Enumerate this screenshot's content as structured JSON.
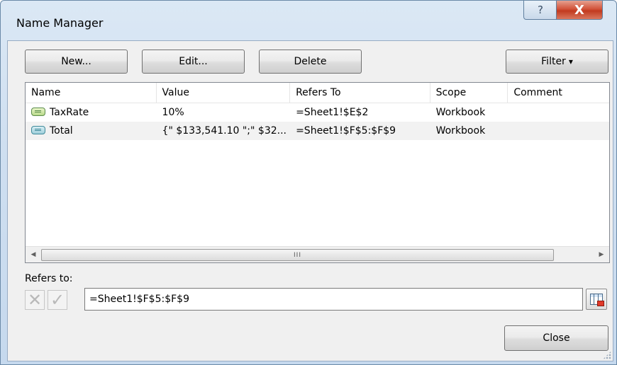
{
  "window": {
    "title": "Name Manager",
    "help_glyph": "?",
    "close_glyph": "X"
  },
  "toolbar": {
    "new_label": "New...",
    "edit_label": "Edit...",
    "delete_label": "Delete",
    "filter_label": "Filter",
    "filter_arrow": "▾"
  },
  "list": {
    "columns": [
      "Name",
      "Value",
      "Refers To",
      "Scope",
      "Comment"
    ],
    "rows": [
      {
        "name": "TaxRate",
        "value": "10%",
        "refers_to": "=Sheet1!$E$2",
        "scope": "Workbook",
        "comment": ""
      },
      {
        "name": "Total",
        "value": "{\" $133,541.10 \";\" $32...",
        "refers_to": "=Sheet1!$F$5:$F$9",
        "scope": "Workbook",
        "comment": ""
      }
    ],
    "scroll_left": "◀",
    "scroll_right": "▶",
    "scroll_grip": "III"
  },
  "refers": {
    "label": "Refers to:",
    "value": "=Sheet1!$F$5:$F$9",
    "cancel_glyph": "✕",
    "confirm_glyph": "✓"
  },
  "footer": {
    "close_label": "Close"
  }
}
